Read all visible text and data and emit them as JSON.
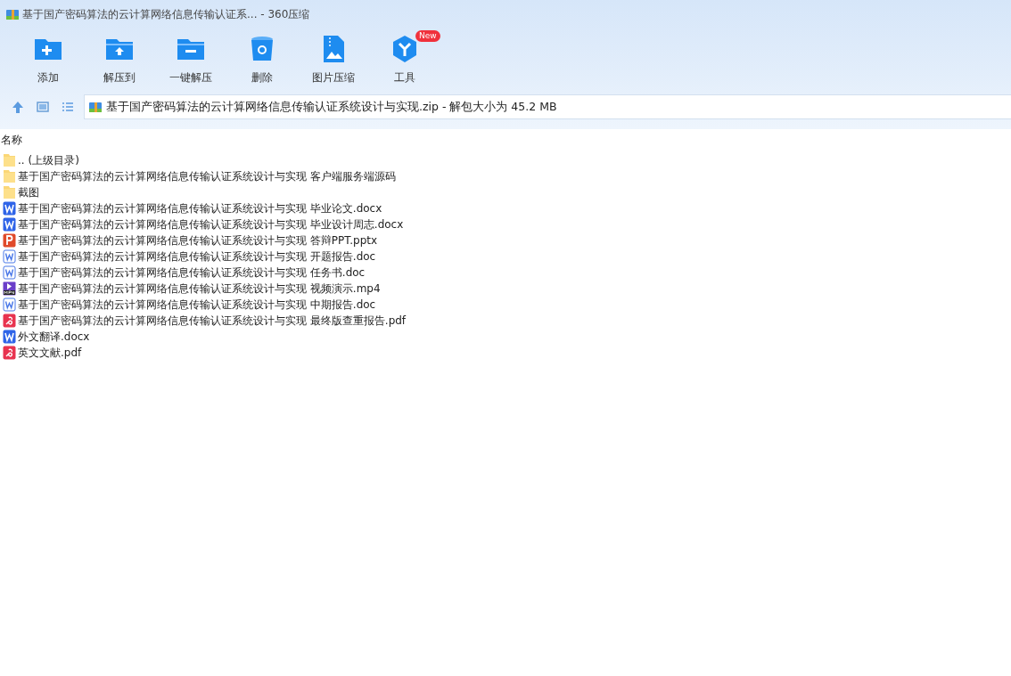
{
  "window": {
    "title": "基于国产密码算法的云计算网络信息传输认证系... - 360压缩"
  },
  "toolbar": [
    {
      "kind": "add",
      "label": "添加"
    },
    {
      "kind": "extract",
      "label": "解压到"
    },
    {
      "kind": "oneclick",
      "label": "一键解压"
    },
    {
      "kind": "delete",
      "label": "删除"
    },
    {
      "kind": "image",
      "label": "图片压缩"
    },
    {
      "kind": "tools",
      "label": "工具",
      "badge": "New"
    }
  ],
  "path_bar": {
    "text": "基于国产密码算法的云计算网络信息传输认证系统设计与实现.zip - 解包大小为 45.2 MB"
  },
  "file_list": {
    "columns": [
      "名称"
    ],
    "rows": [
      {
        "kind": "folder",
        "name": ".. (上级目录)"
      },
      {
        "kind": "folder",
        "name": "基于国产密码算法的云计算网络信息传输认证系统设计与实现 客户端服务端源码"
      },
      {
        "kind": "folder",
        "name": "截图"
      },
      {
        "kind": "docx",
        "name": "基于国产密码算法的云计算网络信息传输认证系统设计与实现 毕业论文.docx"
      },
      {
        "kind": "docx",
        "name": "基于国产密码算法的云计算网络信息传输认证系统设计与实现 毕业设计周志.docx"
      },
      {
        "kind": "pptx",
        "name": "基于国产密码算法的云计算网络信息传输认证系统设计与实现 答辩PPT.pptx"
      },
      {
        "kind": "doc",
        "name": "基于国产密码算法的云计算网络信息传输认证系统设计与实现 开题报告.doc"
      },
      {
        "kind": "doc",
        "name": "基于国产密码算法的云计算网络信息传输认证系统设计与实现 任务书.doc"
      },
      {
        "kind": "mp4",
        "name": "基于国产密码算法的云计算网络信息传输认证系统设计与实现 视频演示.mp4"
      },
      {
        "kind": "doc",
        "name": "基于国产密码算法的云计算网络信息传输认证系统设计与实现 中期报告.doc"
      },
      {
        "kind": "pdf",
        "name": "基于国产密码算法的云计算网络信息传输认证系统设计与实现 最终版查重报告.pdf"
      },
      {
        "kind": "docx",
        "name": "外文翻译.docx"
      },
      {
        "kind": "pdf",
        "name": "英文文献.pdf"
      }
    ]
  }
}
